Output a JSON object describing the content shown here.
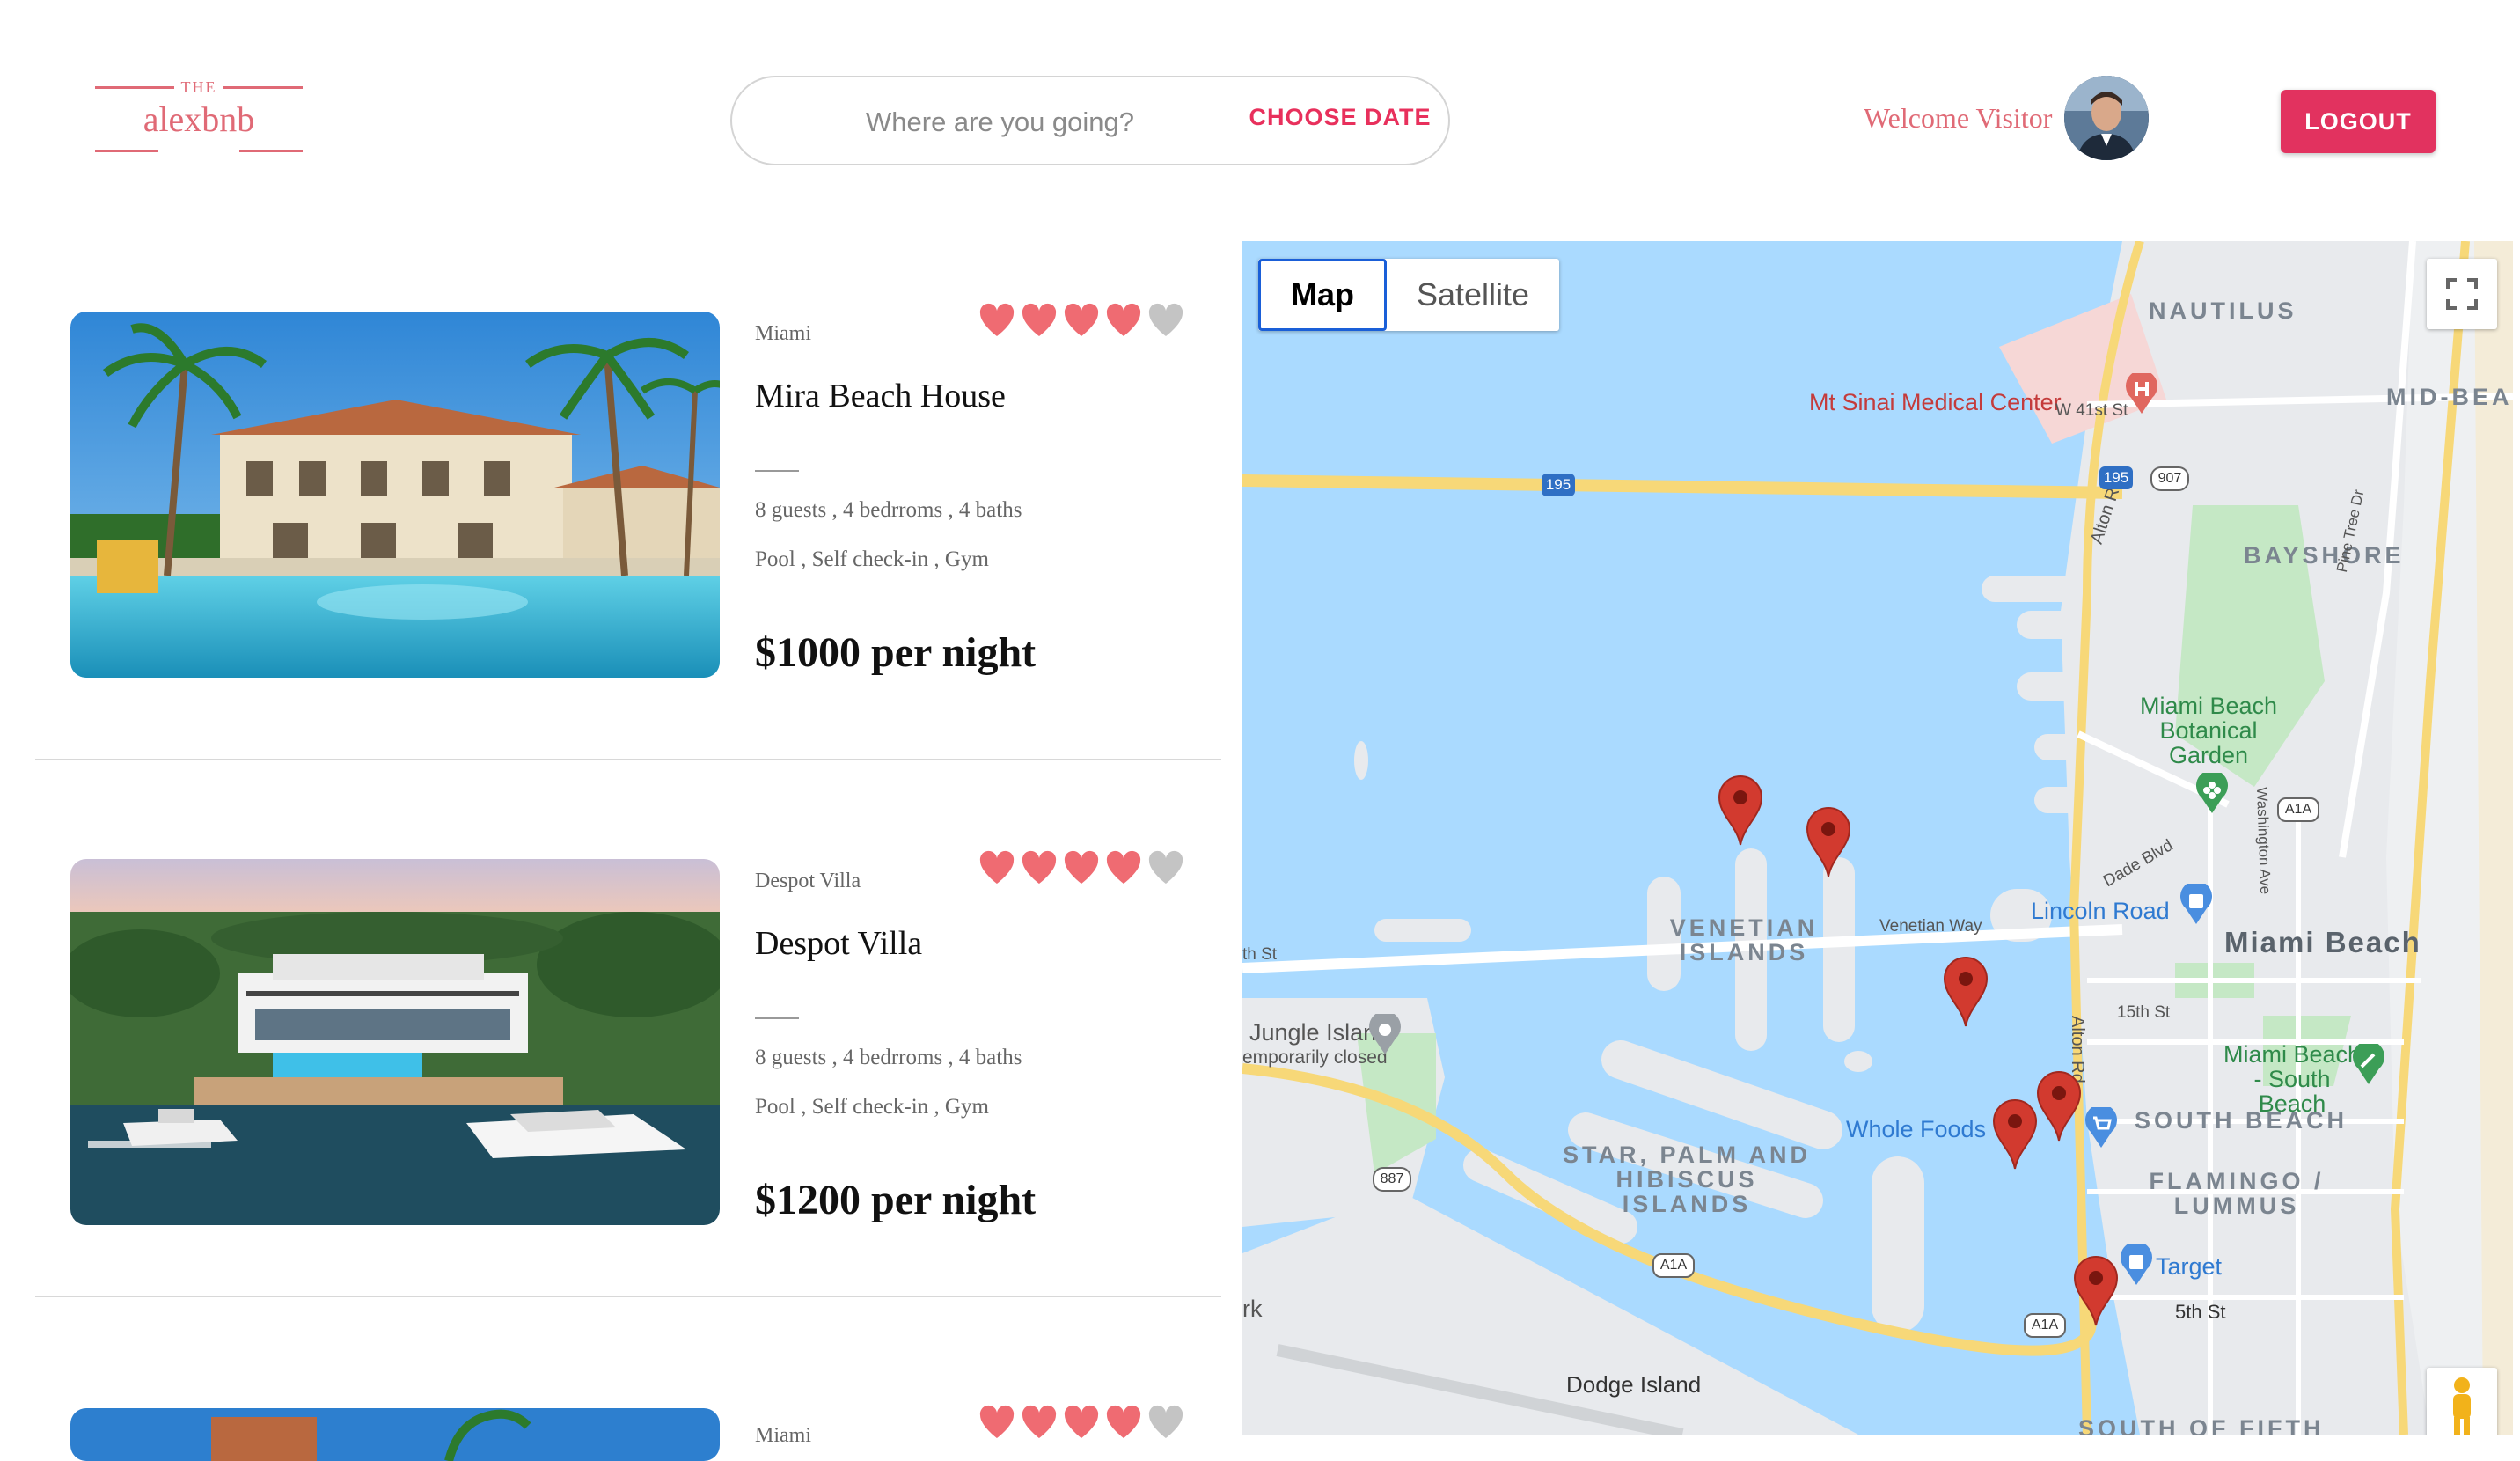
{
  "header": {
    "logo_small": "THE",
    "logo_name": "alexbnb",
    "search_placeholder": "Where are you going?",
    "choose_date": "CHOOSE DATE",
    "welcome": "Welcome Visitor",
    "logout": "LOGOUT"
  },
  "listings": [
    {
      "city": "Miami",
      "title": "Mira Beach House",
      "details": "8 guests , 4 bedrroms , 4 baths",
      "amenities": "Pool , Self check-in , Gym",
      "price": "$1000 per night",
      "rating": 4,
      "rating_max": 5
    },
    {
      "city": "Despot Villa",
      "title": "Despot Villa",
      "details": "8 guests , 4 bedrroms , 4 baths",
      "amenities": "Pool , Self check-in , Gym",
      "price": "$1200 per night",
      "rating": 4,
      "rating_max": 5
    },
    {
      "city": "Miami",
      "rating": 4,
      "rating_max": 5
    }
  ],
  "map": {
    "tabs": [
      "Map",
      "Satellite"
    ],
    "active_tab": "Map",
    "labels": {
      "nautilus": "NAUTILUS",
      "mid_beach": "MID-BEA",
      "mt_sinai": "Mt Sinai Medical Center",
      "w41st": "W 41st St",
      "bayshore": "BAYSHORE",
      "botanical": "Miami Beach Botanical Garden",
      "venetian_islands": "VENETIAN ISLANDS",
      "venetian_way": "Venetian Way",
      "lincoln_road": "Lincoln Road",
      "miami_beach": "Miami Beach",
      "jungle_island": "Jungle Island",
      "temp_closed": "emporarily closed",
      "fifteenth": "15th St",
      "mb_south_beach": "Miami Beach - South Beach",
      "whole_foods": "Whole Foods",
      "south_beach": "SOUTH BEACH",
      "star_palm": "STAR, PALM AND HIBISCUS ISLANDS",
      "flamingo": "FLAMINGO / LUMMUS",
      "target": "Target",
      "fifth": "5th St",
      "dodge_island": "Dodge Island",
      "south_of_fifth": "SOUTH OF FIFTH",
      "alton_rd": "Alton Rd",
      "dade_blvd": "Dade Blvd",
      "washington": "Washington Ave",
      "pine_tree": "Pine Tree Dr",
      "a1a": "A1A",
      "i195": "195",
      "r907": "907",
      "r887": "887",
      "west_st": "th St",
      "rk": "rk"
    }
  }
}
